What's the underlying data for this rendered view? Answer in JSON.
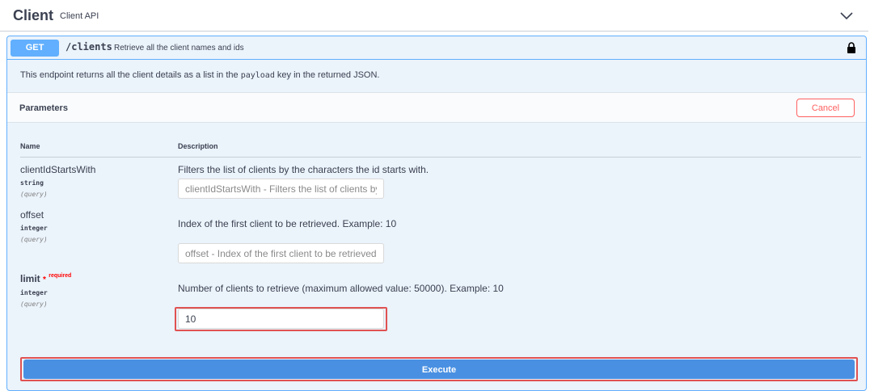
{
  "tag": {
    "name": "Client",
    "description": "Client API"
  },
  "operation": {
    "method": "GET",
    "path": "/clients",
    "summary": "Retrieve all the client names and ids",
    "description_pre": "This endpoint returns all the client details as a list in the ",
    "description_code": "payload",
    "description_post": " key in the returned JSON."
  },
  "parameters_section": {
    "title": "Parameters",
    "cancel_label": "Cancel",
    "columns": [
      "Name",
      "Description"
    ]
  },
  "parameters": [
    {
      "name": "clientIdStartsWith",
      "type": "string",
      "in": "(query)",
      "description": "Filters the list of clients by the characters the id starts with.",
      "placeholder": "clientIdStartsWith - Filters the list of clients by",
      "value": ""
    },
    {
      "name": "offset",
      "type": "integer",
      "in": "(query)",
      "description": "Index of the first client to be retrieved. Example: 10",
      "placeholder": "offset - Index of the first client to be retrieved.",
      "value": ""
    },
    {
      "name": "limit",
      "required_mark": "*",
      "required_text": "required",
      "type": "integer",
      "in": "(query)",
      "description": "Number of clients to retrieve (maximum allowed value: 50000). Example: 10",
      "placeholder": "",
      "value": "10"
    }
  ],
  "execute_label": "Execute",
  "colors": {
    "get_blue": "#61affe",
    "opblock_bg": "#ebf3fb",
    "execute_blue": "#4a90e2",
    "cancel_red": "#ff6060",
    "highlight_red": "#e05252"
  },
  "icons": [
    "chevron-down-icon",
    "lock-icon"
  ]
}
